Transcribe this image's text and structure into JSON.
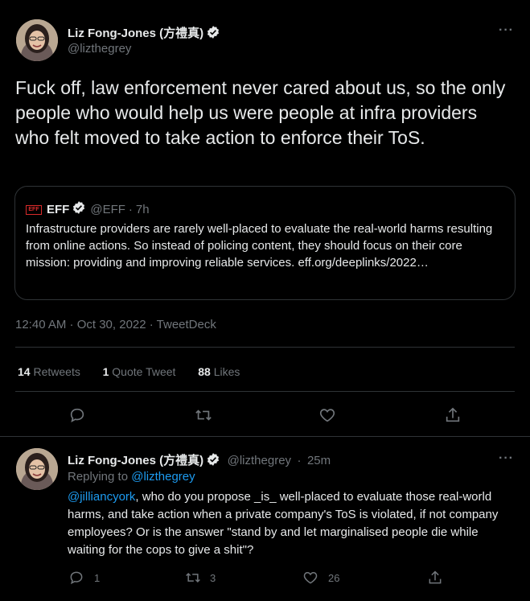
{
  "main_tweet": {
    "author_name": "Liz Fong-Jones (方禮真)",
    "author_handle": "@lizthegrey",
    "more_label": "···",
    "text": "Fuck off, law enforcement never cared about us, so the only people who would help us were people at infra providers who felt moved to take action to enforce their ToS.",
    "quote": {
      "logo_text": "EFF",
      "author_name": "EFF",
      "author_handle": "@EFF",
      "separator": "·",
      "time": "7h",
      "text": "Infrastructure providers are rarely well-placed to evaluate the real-world harms resulting from online actions. So instead of policing content, they should focus on their core mission: providing and improving reliable services.",
      "link": "eff.org/deeplinks/2022…"
    },
    "timestamp": "12:40 AM · Oct 30, 2022 · TweetDeck",
    "stats": {
      "retweets_count": "14",
      "retweets_label": "Retweets",
      "quotes_count": "1",
      "quotes_label": "Quote Tweet",
      "likes_count": "88",
      "likes_label": "Likes"
    },
    "actions": [
      "reply-icon",
      "retweet-icon",
      "like-icon",
      "share-icon"
    ]
  },
  "reply_tweet": {
    "author_name": "Liz Fong-Jones (方禮真)",
    "author_handle": "@lizthegrey",
    "separator": "·",
    "time": "25m",
    "more_label": "···",
    "replying_to_label": "Replying to",
    "replying_to_handle": "@lizthegrey",
    "mention": "@jilliancyork",
    "text": ", who do you propose _is_ well-placed to evaluate those real-world harms, and take action when a private company's ToS is violated, if not company employees? Or is the answer \"stand by and let marginalised people die while waiting for the cops to give a shit\"?",
    "reply_count": "1",
    "retweet_count": "3",
    "like_count": "26"
  },
  "colors": {
    "background": "#000000",
    "text": "#e7e9ea",
    "muted": "#71767b",
    "accent": "#1d9bf0",
    "divider": "#2f3336",
    "eff_red": "#d92b2b"
  }
}
